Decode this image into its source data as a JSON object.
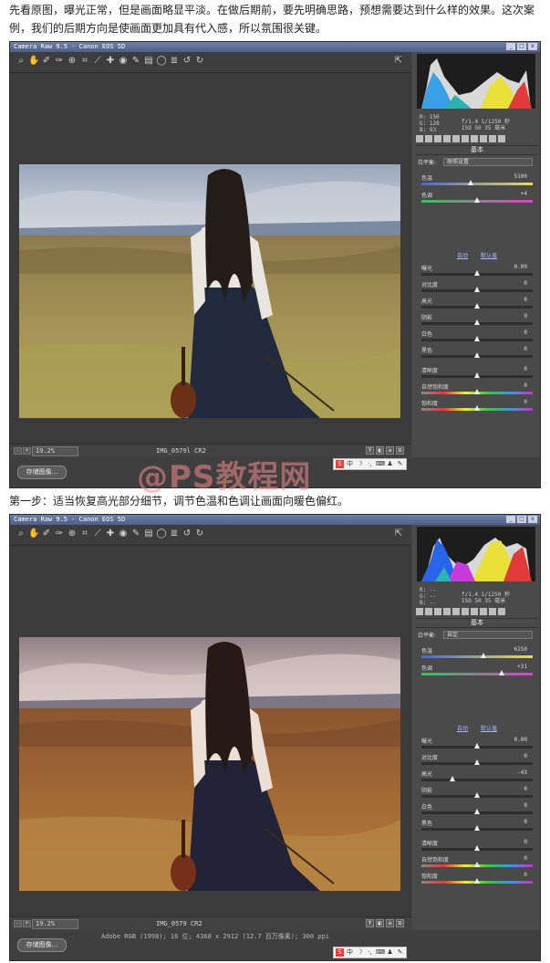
{
  "intro_text": "先看原图，曝光正常，但是画面略显平淡。在做后期前，要先明确思路，预想需要达到什么样的效果。这次案例，我们的后期方向是使画面更加具有代入感，所以氛围很关键。",
  "step1_text": "第一步：适当恢复高光部分细节，调节色温和色调让画面向暖色偏红。",
  "watermark": "@PS教程网",
  "screens": [
    {
      "title": "Camera Raw 9.5 -  Canon EOS 5D",
      "toolbar_icons": [
        "zoom-icon",
        "hand-icon",
        "white-balance-icon",
        "color-sampler-icon",
        "target-adjust-icon",
        "crop-icon",
        "straighten-icon",
        "spot-removal-icon",
        "red-eye-icon",
        "adjustment-brush-icon",
        "graduated-filter-icon",
        "radial-filter-icon",
        "preferences-icon",
        "rotate-left-icon",
        "rotate-right-icon"
      ],
      "zoom": "19.2%",
      "filename": "IMG_0579l CR2",
      "workflow": "",
      "save_label": "存储图像...",
      "readout": {
        "r": "R: 150",
        "g": "G: 128",
        "b": "B: 93",
        "exposure": "f/1.4  1/1250 秒",
        "iso": "ISO 50   35 毫米"
      },
      "section_title": "基本",
      "white_balance_label": "白平衡:",
      "white_balance_value": "原照设置",
      "auto_label": "自动",
      "default_label": "默认值",
      "sliders": [
        {
          "label": "色温",
          "value": "5100",
          "pos": 0.44,
          "grad": "temp"
        },
        {
          "label": "色调",
          "value": "+4",
          "pos": 0.5,
          "grad": "tint"
        },
        {
          "label": "曝光",
          "value": "0.00",
          "pos": 0.5,
          "grad": ""
        },
        {
          "label": "对比度",
          "value": "0",
          "pos": 0.5,
          "grad": ""
        },
        {
          "label": "高光",
          "value": "0",
          "pos": 0.5,
          "grad": ""
        },
        {
          "label": "阴影",
          "value": "0",
          "pos": 0.5,
          "grad": ""
        },
        {
          "label": "白色",
          "value": "0",
          "pos": 0.5,
          "grad": ""
        },
        {
          "label": "黑色",
          "value": "0",
          "pos": 0.5,
          "grad": ""
        },
        {
          "label": "清晰度",
          "value": "0",
          "pos": 0.5,
          "grad": ""
        },
        {
          "label": "自然饱和度",
          "value": "0",
          "pos": 0.5,
          "grad": "sat"
        },
        {
          "label": "饱和度",
          "value": "0",
          "pos": 0.5,
          "grad": "sat"
        }
      ]
    },
    {
      "title": "Camera Raw 9.5 -  Canon EOS 5D",
      "toolbar_icons": [
        "zoom-icon",
        "hand-icon",
        "white-balance-icon",
        "color-sampler-icon",
        "target-adjust-icon",
        "crop-icon",
        "straighten-icon",
        "spot-removal-icon",
        "red-eye-icon",
        "adjustment-brush-icon",
        "graduated-filter-icon",
        "radial-filter-icon",
        "preferences-icon",
        "rotate-left-icon",
        "rotate-right-icon"
      ],
      "zoom": "19.2%",
      "filename": "IMG_0579 CR2",
      "workflow": "Adobe RGB (1998); 16 位; 4368 x 2912 (12.7 百万像素); 300 ppi",
      "save_label": "存储图像...",
      "readout": {
        "r": "R: --",
        "g": "G: --",
        "b": "B: --",
        "exposure": "f/1.4  1/1250 秒",
        "iso": "ISO 50   35 毫米"
      },
      "section_title": "基本",
      "white_balance_label": "白平衡:",
      "white_balance_value": "自定",
      "auto_label": "自动",
      "default_label": "默认值",
      "sliders": [
        {
          "label": "色温",
          "value": "6150",
          "pos": 0.56,
          "grad": "temp"
        },
        {
          "label": "色调",
          "value": "+31",
          "pos": 0.72,
          "grad": "tint"
        },
        {
          "label": "曝光",
          "value": "0.00",
          "pos": 0.5,
          "grad": ""
        },
        {
          "label": "对比度",
          "value": "0",
          "pos": 0.5,
          "grad": ""
        },
        {
          "label": "高光",
          "value": "-43",
          "pos": 0.28,
          "grad": ""
        },
        {
          "label": "阴影",
          "value": "0",
          "pos": 0.5,
          "grad": ""
        },
        {
          "label": "白色",
          "value": "0",
          "pos": 0.5,
          "grad": ""
        },
        {
          "label": "黑色",
          "value": "0",
          "pos": 0.5,
          "grad": ""
        },
        {
          "label": "清晰度",
          "value": "0",
          "pos": 0.5,
          "grad": ""
        },
        {
          "label": "自然饱和度",
          "value": "0",
          "pos": 0.5,
          "grad": "sat"
        },
        {
          "label": "饱和度",
          "value": "0",
          "pos": 0.5,
          "grad": "sat"
        }
      ]
    }
  ]
}
